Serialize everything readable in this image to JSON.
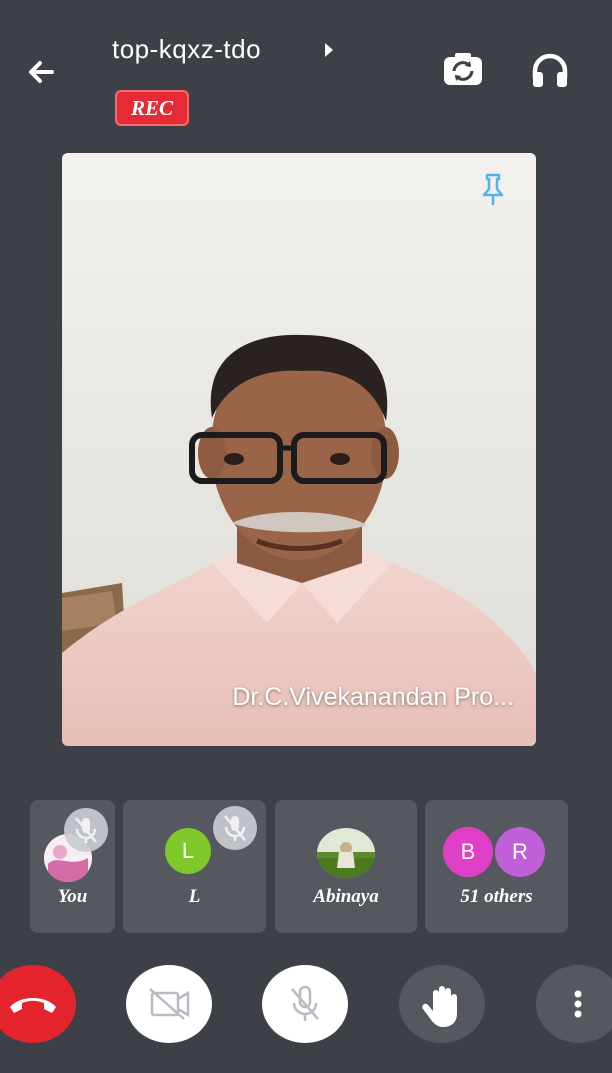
{
  "header": {
    "meeting_code": "top-kqxz-tdo",
    "rec_label": "REC"
  },
  "main_video": {
    "participant_name": "Dr.C.Vivekanandan Pro..."
  },
  "participants": [
    {
      "label": "You",
      "muted": true
    },
    {
      "label": "L",
      "avatar_letter": "L",
      "avatar_color": "#7ec82a",
      "muted": true
    },
    {
      "label": "Abinaya",
      "muted": false
    },
    {
      "label": "51 others",
      "avatar_letters": [
        "B",
        "R"
      ],
      "avatar_colors": [
        "#e040c8",
        "#c060d8"
      ]
    }
  ],
  "controls": {
    "end_call_color": "#e5252e",
    "icons": [
      "phone-hangup-icon",
      "video-off-icon",
      "mic-off-icon",
      "raise-hand-icon",
      "more-vert-icon"
    ]
  },
  "colors": {
    "background": "#3d4046",
    "tile": "#55585f",
    "rec": "#e52b34",
    "pin": "#4fb3f0"
  }
}
